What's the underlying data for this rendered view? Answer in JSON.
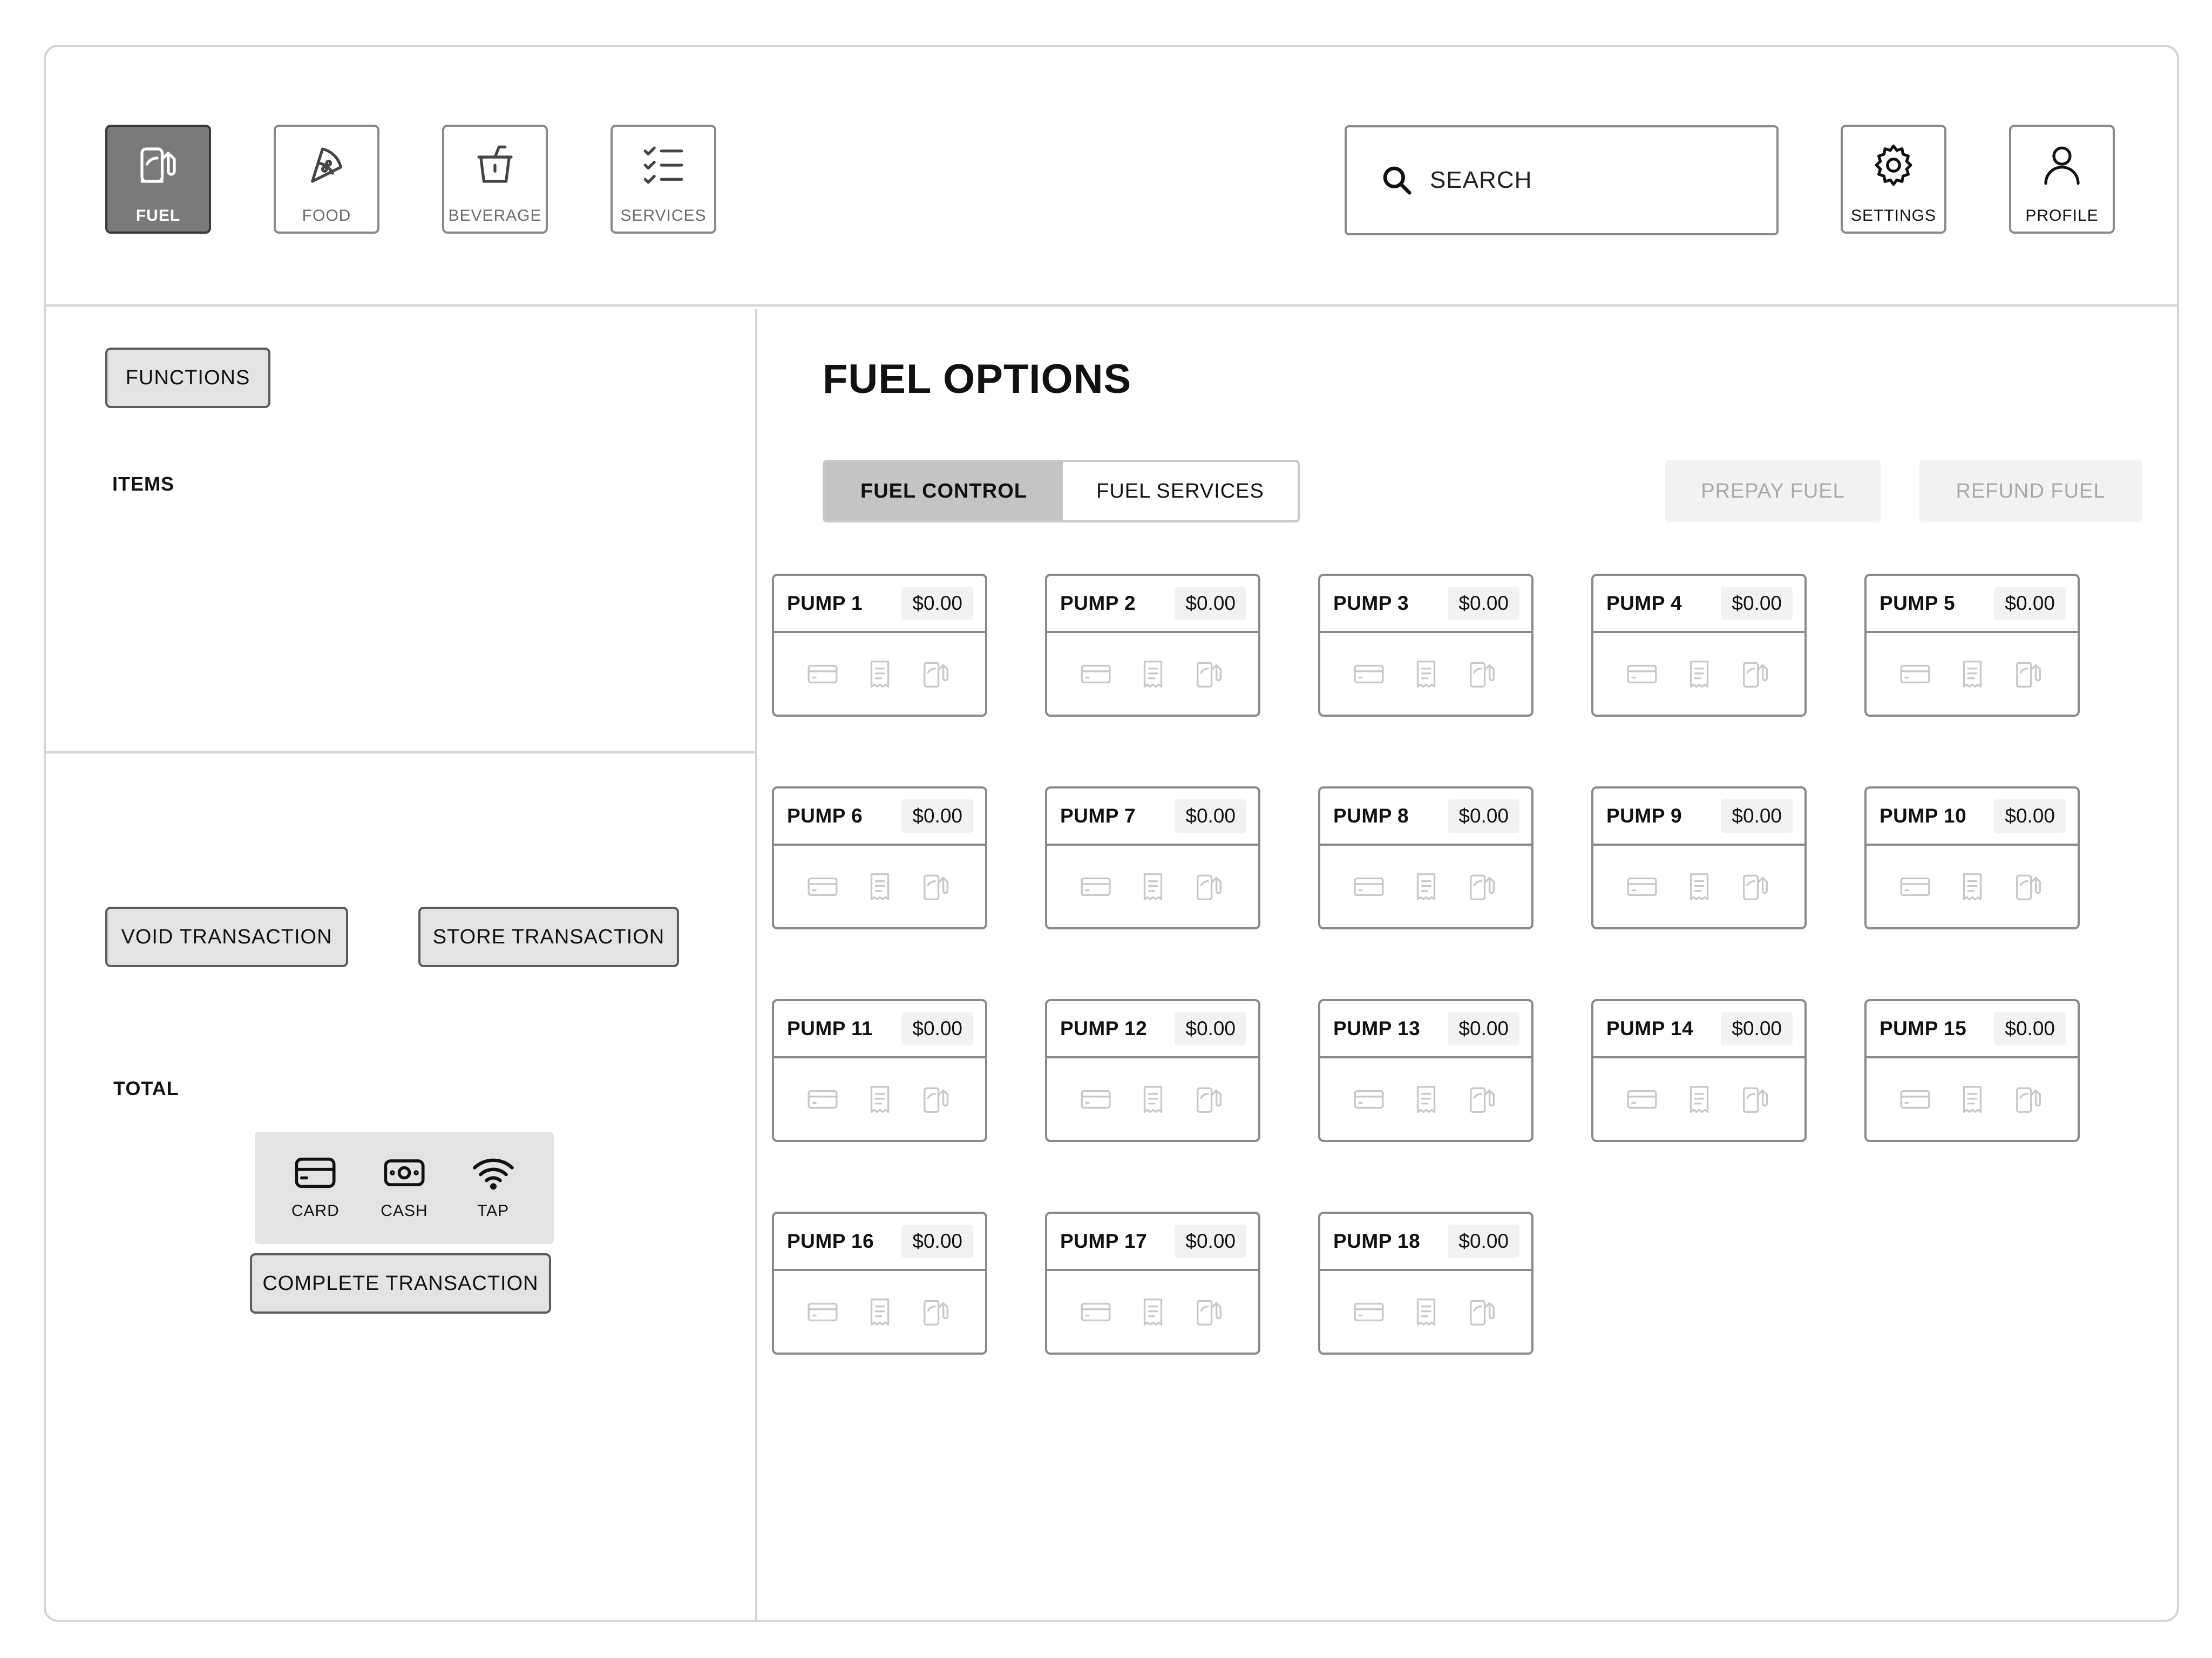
{
  "categories": [
    {
      "label": "FUEL",
      "icon": "fuel-pump-icon",
      "active": true
    },
    {
      "label": "FOOD",
      "icon": "pizza-icon",
      "active": false
    },
    {
      "label": "BEVERAGE",
      "icon": "cup-icon",
      "active": false
    },
    {
      "label": "SERVICES",
      "icon": "checklist-icon",
      "active": false
    }
  ],
  "search": {
    "placeholder": "SEARCH"
  },
  "settings": {
    "label": "SETTINGS"
  },
  "profile": {
    "label": "PROFILE"
  },
  "left": {
    "functions_label": "FUNCTIONS",
    "items_label": "ITEMS",
    "void_label": "VOID TRANSACTION",
    "store_label": "STORE TRANSACTION",
    "total_label": "TOTAL",
    "payment": [
      {
        "label": "CARD",
        "icon": "card-icon"
      },
      {
        "label": "CASH",
        "icon": "cash-icon"
      },
      {
        "label": "TAP",
        "icon": "wireless-icon"
      }
    ],
    "complete_label": "COMPLETE TRANSACTION"
  },
  "main": {
    "title": "FUEL OPTIONS",
    "tabs": [
      {
        "label": "FUEL CONTROL",
        "active": true
      },
      {
        "label": "FUEL SERVICES",
        "active": false
      }
    ],
    "prepay_label": "PREPAY FUEL",
    "refund_label": "REFUND FUEL",
    "pumps": [
      {
        "name": "PUMP 1",
        "amount": "$0.00"
      },
      {
        "name": "PUMP 2",
        "amount": "$0.00"
      },
      {
        "name": "PUMP 3",
        "amount": "$0.00"
      },
      {
        "name": "PUMP 4",
        "amount": "$0.00"
      },
      {
        "name": "PUMP 5",
        "amount": "$0.00"
      },
      {
        "name": "PUMP 6",
        "amount": "$0.00"
      },
      {
        "name": "PUMP 7",
        "amount": "$0.00"
      },
      {
        "name": "PUMP 8",
        "amount": "$0.00"
      },
      {
        "name": "PUMP 9",
        "amount": "$0.00"
      },
      {
        "name": "PUMP 10",
        "amount": "$0.00"
      },
      {
        "name": "PUMP 11",
        "amount": "$0.00"
      },
      {
        "name": "PUMP 12",
        "amount": "$0.00"
      },
      {
        "name": "PUMP 13",
        "amount": "$0.00"
      },
      {
        "name": "PUMP 14",
        "amount": "$0.00"
      },
      {
        "name": "PUMP 15",
        "amount": "$0.00"
      },
      {
        "name": "PUMP 16",
        "amount": "$0.00"
      },
      {
        "name": "PUMP 17",
        "amount": "$0.00"
      },
      {
        "name": "PUMP 18",
        "amount": "$0.00"
      }
    ],
    "pump_action_icons": [
      "card-icon",
      "receipt-icon",
      "fuel-pump-icon"
    ]
  }
}
